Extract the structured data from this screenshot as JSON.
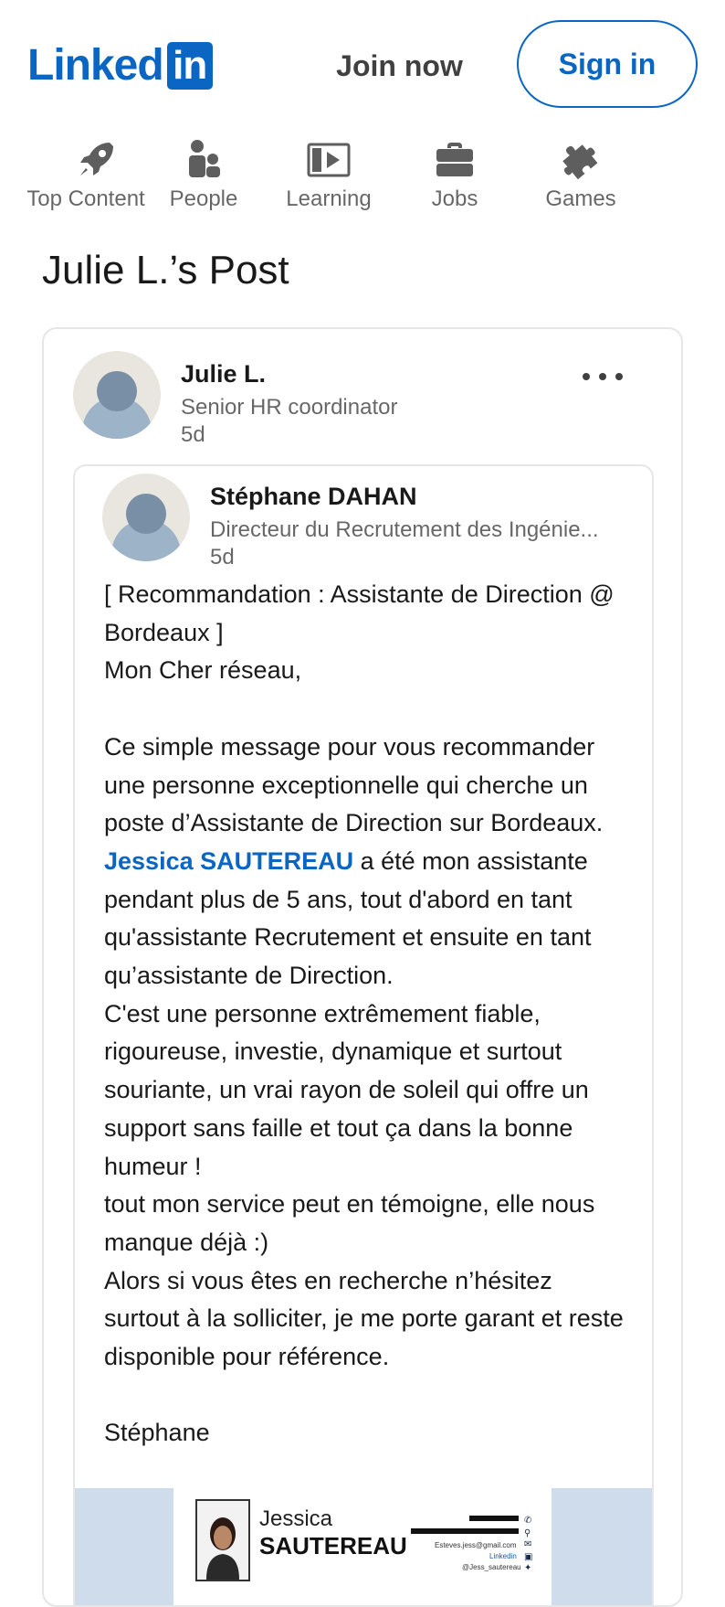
{
  "header": {
    "logo_text": "Linked",
    "logo_box": "in",
    "join_label": "Join now",
    "signin_label": "Sign in",
    "brand_color": "#0a66c2"
  },
  "nav": {
    "items": [
      {
        "label": "Top Content",
        "icon": "rocket-icon"
      },
      {
        "label": "People",
        "icon": "people-icon"
      },
      {
        "label": "Learning",
        "icon": "video-icon"
      },
      {
        "label": "Jobs",
        "icon": "briefcase-icon"
      },
      {
        "label": "Games",
        "icon": "puzzle-icon"
      }
    ]
  },
  "page_title": "Julie L.’s Post",
  "post": {
    "author": {
      "name": "Julie L.",
      "headline": "Senior HR coordinator",
      "time": "5d"
    },
    "more_icon": "ellipsis-icon",
    "shared": {
      "author": {
        "name": "Stéphane DAHAN",
        "headline": "Directeur du Recrutement des Ingénie...",
        "time": "5d"
      },
      "lines": {
        "l1": "[ Recommandation : Assistante de Direction @ Bordeaux ]",
        "l2": "Mon Cher réseau,",
        "l3": "Ce simple message pour vous recommander une personne exceptionnelle qui cherche un poste d’Assistante de Direction sur Bordeaux.",
        "mention": "Jessica SAUTEREAU",
        "l4": " a été mon assistante pendant plus de 5 ans, tout d'abord en tant qu'assistante Recrutement et ensuite en tant qu’assistante de Direction.",
        "l5": "C'est une personne extrêmement fiable, rigoureuse, investie, dynamique et surtout souriante, un vrai rayon de soleil qui offre un support sans faille et tout ça dans la bonne humeur !",
        "l6": "tout mon service peut en témoigne, elle nous manque déjà :)",
        "l7": "Alors si vous êtes en recherche n’hésitez surtout à la solliciter, je me porte garant et reste disponible pour référence.",
        "l8": "Stéphane"
      },
      "image": {
        "first_name": "Jessica",
        "last_name": "SAUTEREAU",
        "email": "Esteves.jess@gmail.com",
        "linkedin": "Linkedin",
        "handle": "@Jess_sautereau"
      }
    }
  }
}
